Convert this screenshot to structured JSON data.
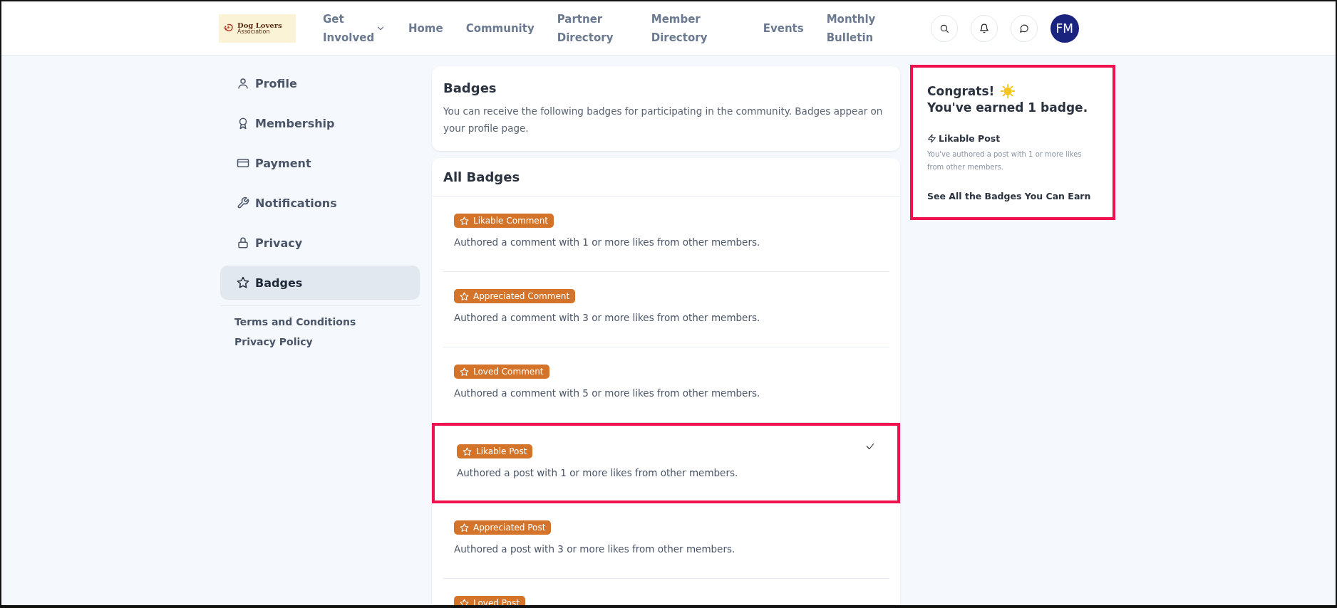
{
  "header": {
    "logo": {
      "name": "Dog Lovers",
      "sub": "Association"
    },
    "nav": [
      {
        "label": "Get Involved",
        "dropdown": true
      },
      {
        "label": "Home",
        "dropdown": false
      },
      {
        "label": "Community",
        "dropdown": false
      },
      {
        "label": "Partner Directory",
        "dropdown": false
      },
      {
        "label": "Member Directory",
        "dropdown": false
      },
      {
        "label": "Events",
        "dropdown": false
      },
      {
        "label": "Monthly Bulletin",
        "dropdown": false
      }
    ],
    "avatar": "FM"
  },
  "sidebar": {
    "items": [
      {
        "label": "Profile",
        "selected": false
      },
      {
        "label": "Membership",
        "selected": false
      },
      {
        "label": "Payment",
        "selected": false
      },
      {
        "label": "Notifications",
        "selected": false
      },
      {
        "label": "Privacy",
        "selected": false
      },
      {
        "label": "Badges",
        "selected": true
      }
    ],
    "links": [
      "Terms and Conditions",
      "Privacy Policy"
    ]
  },
  "intro": {
    "title": "Badges",
    "text": "You can receive the following badges for participating in the community. Badges appear on your profile page."
  },
  "all_badges": {
    "title": "All Badges",
    "items": [
      {
        "name": "Likable Comment",
        "description": "Authored a comment with 1 or more likes from other members.",
        "earned": false,
        "highlighted": false
      },
      {
        "name": "Appreciated Comment",
        "description": "Authored a comment with 3 or more likes from other members.",
        "earned": false,
        "highlighted": false
      },
      {
        "name": "Loved Comment",
        "description": "Authored a comment with 5 or more likes from other members.",
        "earned": false,
        "highlighted": false
      },
      {
        "name": "Likable Post",
        "description": "Authored a post with 1 or more likes from other members.",
        "earned": true,
        "highlighted": true
      },
      {
        "name": "Appreciated Post",
        "description": "Authored a post with 3 or more likes from other members.",
        "earned": false,
        "highlighted": false
      },
      {
        "name": "Loved Post",
        "earned": false,
        "highlighted": false
      }
    ]
  },
  "congrats": {
    "title": "Congrats!",
    "subtitle": "You've earned 1 badge.",
    "highlighted": true,
    "earned": [
      {
        "name": "Likable Post",
        "description": "You've authored a post with 1 or more likes from other members."
      }
    ],
    "link": "See All the Badges You Can Earn"
  }
}
